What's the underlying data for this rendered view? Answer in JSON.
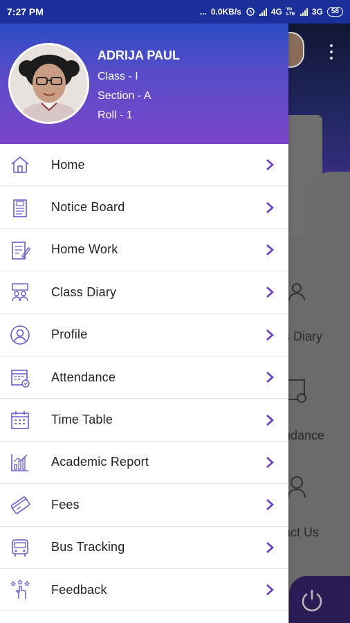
{
  "status_bar": {
    "time": "7:27 PM",
    "dots": "...",
    "network_speed": "0.0KB/s",
    "alarm_icon": "alarm-icon",
    "network1": "4G",
    "volte": "Vo LTE",
    "network2": "3G",
    "battery": "58"
  },
  "drawer": {
    "profile": {
      "name": "ADRIJA PAUL",
      "class": "Class - I",
      "section": "Section - A",
      "roll": "Roll - 1"
    },
    "menu": [
      {
        "label": "Home",
        "icon": "home-icon"
      },
      {
        "label": "Notice Board",
        "icon": "notice-board-icon"
      },
      {
        "label": "Home Work",
        "icon": "homework-icon"
      },
      {
        "label": "Class Diary",
        "icon": "class-diary-icon"
      },
      {
        "label": "Profile",
        "icon": "profile-icon"
      },
      {
        "label": "Attendance",
        "icon": "attendance-icon"
      },
      {
        "label": "Time Table",
        "icon": "time-table-icon"
      },
      {
        "label": "Academic Report",
        "icon": "academic-report-icon"
      },
      {
        "label": "Fees",
        "icon": "fees-icon"
      },
      {
        "label": "Bus Tracking",
        "icon": "bus-tracking-icon"
      },
      {
        "label": "Feedback",
        "icon": "feedback-icon"
      }
    ]
  },
  "background": {
    "tiles": [
      "s Diary",
      "ndance",
      "act Us"
    ]
  },
  "colors": {
    "accent": "#6a3cc4",
    "icon": "#6b58c9",
    "header_top": "#2d4cc4",
    "header_bottom": "#7b45c8"
  }
}
